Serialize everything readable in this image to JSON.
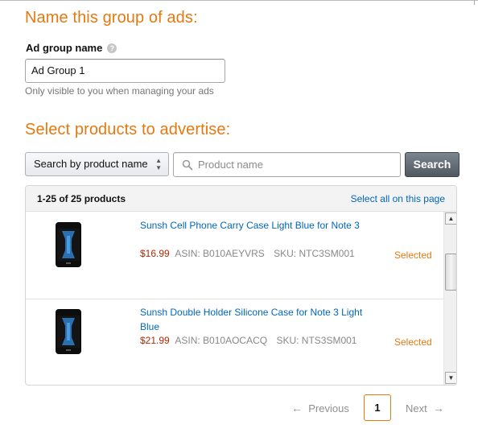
{
  "group_section": {
    "title": "Name this group of ads:",
    "field_label": "Ad group name",
    "help_icon": "?",
    "input_value": "Ad Group 1",
    "hint": "Only visible to you when managing your ads"
  },
  "products_section": {
    "title": "Select products to advertise:",
    "search_mode": "Search by product name",
    "search_placeholder": "Product name",
    "search_button": "Search"
  },
  "results": {
    "count_label": "1-25 of 25 products",
    "select_all_label": "Select all on this page",
    "items": [
      {
        "title": "Sunsh Cell Phone Carry Case Light Blue for Note 3",
        "price": "$16.99",
        "asin": "ASIN: B010AEYVRS",
        "sku": "SKU: NTC3SM001",
        "status": "Selected"
      },
      {
        "title": "Sunsh Double Holder Silicone Case for Note 3 Light Blue",
        "price": "$21.99",
        "asin": "ASIN: B010AOCACQ",
        "sku": "SKU: NTS3SM001",
        "status": "Selected"
      }
    ]
  },
  "pagination": {
    "prev_label": "Previous",
    "current_page": "1",
    "next_label": "Next",
    "prev_arrow": "←",
    "next_arrow": "→"
  },
  "colors": {
    "accent_orange": "#e47911",
    "link_blue": "#0066c0",
    "price_red": "#b12704"
  },
  "icons": {
    "help": "help-icon",
    "search": "search-icon",
    "select_arrows": "select-arrows-icon",
    "scroll_up": "scroll-up-icon",
    "scroll_down": "scroll-down-icon"
  }
}
